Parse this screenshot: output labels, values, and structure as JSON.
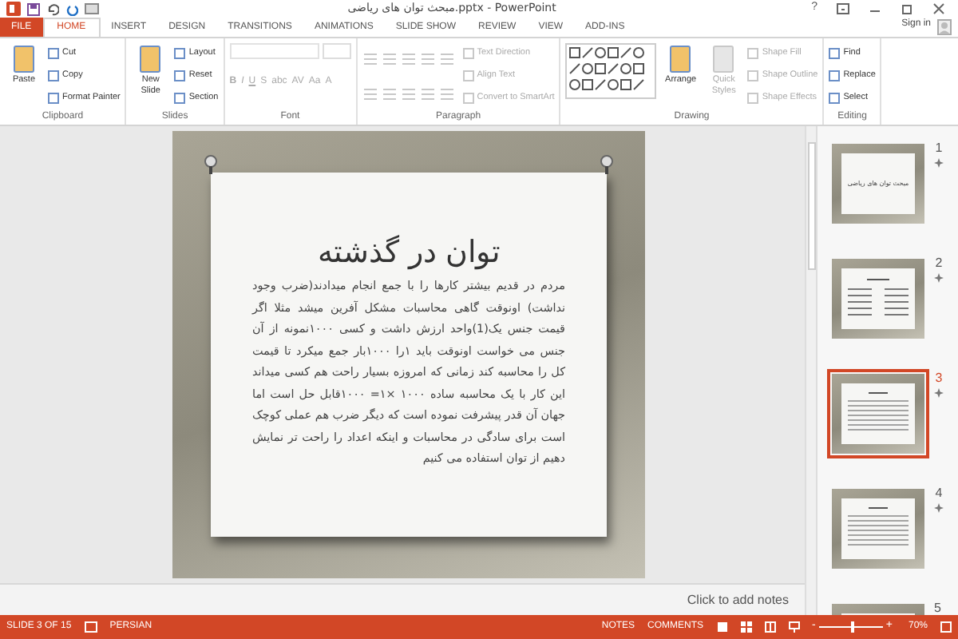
{
  "window": {
    "title": "مبحث توان های ریاضی.pptx - PowerPoint",
    "sign_in": "Sign in",
    "help": "?"
  },
  "tabs": [
    {
      "label": "FILE",
      "kind": "file",
      "selected": false
    },
    {
      "label": "HOME",
      "kind": "tab",
      "selected": true
    },
    {
      "label": "INSERT",
      "kind": "tab",
      "selected": false
    },
    {
      "label": "DESIGN",
      "kind": "tab",
      "selected": false
    },
    {
      "label": "TRANSITIONS",
      "kind": "tab",
      "selected": false
    },
    {
      "label": "ANIMATIONS",
      "kind": "tab",
      "selected": false
    },
    {
      "label": "SLIDE SHOW",
      "kind": "tab",
      "selected": false
    },
    {
      "label": "REVIEW",
      "kind": "tab",
      "selected": false
    },
    {
      "label": "VIEW",
      "kind": "tab",
      "selected": false
    },
    {
      "label": "ADD-INS",
      "kind": "tab",
      "selected": false
    }
  ],
  "ribbon": [
    {
      "label": "Clipboard",
      "columns": [
        [
          {
            "kind": "large",
            "label": "Paste",
            "disabled": false
          }
        ],
        [
          {
            "kind": "small",
            "label": "Cut",
            "disabled": false
          },
          {
            "kind": "small",
            "label": "Copy",
            "disabled": false
          },
          {
            "kind": "small",
            "label": "Format Painter",
            "disabled": false
          }
        ]
      ]
    },
    {
      "label": "Slides",
      "columns": [
        [
          {
            "kind": "large",
            "label": "New Slide",
            "disabled": false
          }
        ],
        [
          {
            "kind": "small",
            "label": "Layout",
            "disabled": false
          },
          {
            "kind": "small",
            "label": "Reset",
            "disabled": false
          },
          {
            "kind": "small",
            "label": "Section",
            "disabled": false
          }
        ]
      ]
    },
    {
      "label": "Font",
      "columns": [
        [
          {
            "kind": "fields",
            "disabled": true
          },
          {
            "kind": "letters",
            "labels": [
              "B",
              "I",
              "U",
              "S",
              "abc",
              "AV",
              "Aa",
              "A"
            ],
            "disabled": true
          }
        ]
      ]
    },
    {
      "label": "Paragraph",
      "columns": [
        [
          {
            "kind": "icons",
            "disabled": true
          },
          {
            "kind": "icons",
            "disabled": true
          }
        ],
        [
          {
            "kind": "small",
            "label": "Text Direction",
            "disabled": true
          },
          {
            "kind": "small",
            "label": "Align Text",
            "disabled": true
          },
          {
            "kind": "small",
            "label": "Convert to SmartArt",
            "disabled": true
          }
        ]
      ]
    },
    {
      "label": "Drawing",
      "columns": [
        [
          {
            "kind": "gallery",
            "disabled": false
          }
        ],
        [
          {
            "kind": "large",
            "label": "Arrange",
            "disabled": false
          }
        ],
        [
          {
            "kind": "large",
            "label": "Quick Styles",
            "disabled": true
          }
        ],
        [
          {
            "kind": "small",
            "label": "Shape Fill",
            "disabled": true
          },
          {
            "kind": "small",
            "label": "Shape Outline",
            "disabled": true
          },
          {
            "kind": "small",
            "label": "Shape Effects",
            "disabled": true
          }
        ]
      ]
    },
    {
      "label": "Editing",
      "columns": [
        [
          {
            "kind": "small",
            "label": "Find",
            "disabled": false
          },
          {
            "kind": "small",
            "label": "Replace",
            "disabled": false
          },
          {
            "kind": "small",
            "label": "Select",
            "disabled": false
          }
        ]
      ]
    }
  ],
  "slide": {
    "title": "توان در گذشته",
    "body": "مردم در قدیم بیشتر کارها را با جمع انجام میدادند(ضرب وجود نداشت) اونوقت گاهی محاسبات مشکل آفرین میشد مثلا اگر قیمت جنس یک(1)واحد ارزش داشت و کسی ۱۰۰۰نمونه از آن جنس می خواست اونوقت باید ۱را ۱۰۰۰بار جمع میکرد تا قیمت کل را محاسبه کند زمانی که امروزه بسیار راحت هم کسی میداند این کار با یک محاسبه ساده ۱۰۰۰ ×۱= ۱۰۰۰قابل حل است اما جهان آن قدر پیشرفت نموده است که دیگر ضرب هم عملی کوچک است برای سادگی در محاسبات و اینکه اعداد را راحت تر نمایش دهیم از توان استفاده می کنیم"
  },
  "notes": {
    "placeholder": "Click to add notes"
  },
  "thumbnails": [
    {
      "number": "1",
      "kind": "title",
      "title": "مبحث توان های ریاضی",
      "selected": false,
      "animated": true
    },
    {
      "number": "2",
      "kind": "columns",
      "selected": false,
      "animated": true
    },
    {
      "number": "3",
      "kind": "text",
      "selected": true,
      "animated": true
    },
    {
      "number": "4",
      "kind": "text",
      "selected": false,
      "animated": true
    },
    {
      "number": "5",
      "kind": "partial",
      "selected": false,
      "animated": false
    }
  ],
  "status_bar": {
    "slide": "SLIDE 3 OF 15",
    "language": "PERSIAN",
    "notes": "NOTES",
    "comments": "COMMENTS",
    "zoom": "70%",
    "zoom_out": "-",
    "zoom_in": "+",
    "zoom_slider": {
      "level": 0.5
    }
  }
}
